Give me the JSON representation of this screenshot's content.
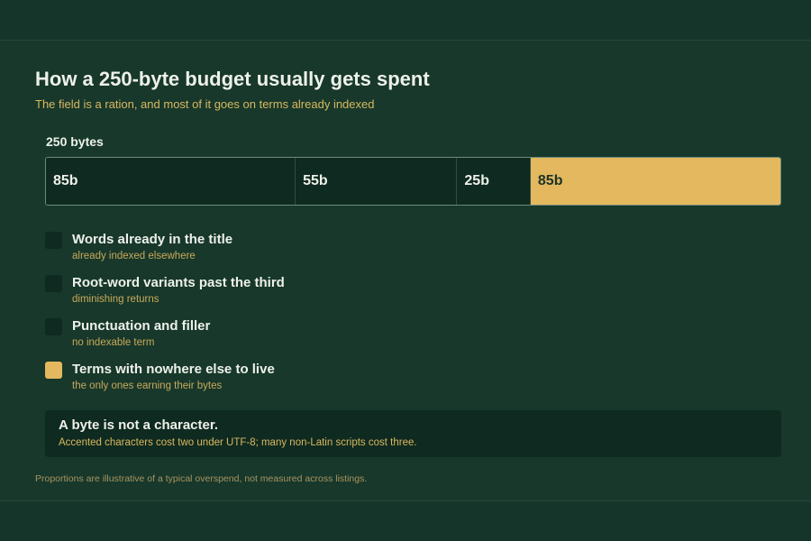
{
  "title": "How a 250-byte budget usually gets spent",
  "subtitle": "The field is a ration, and most of it goes on terms already indexed",
  "chart_data": {
    "type": "bar",
    "orientation": "horizontal-stacked",
    "total": 250,
    "total_label": "250 bytes",
    "unit": "bytes",
    "categories": [
      "Words already in the title",
      "Root-word variants past the third",
      "Punctuation and filler",
      "Terms with nowhere else to live"
    ],
    "values": [
      85,
      55,
      25,
      85
    ],
    "value_labels": [
      "85b",
      "55b",
      "25b",
      "85b"
    ],
    "notes": [
      "already indexed elsewhere",
      "diminishing returns",
      "no indexable term",
      "the only ones earning their bytes"
    ],
    "colors": [
      "#0f2a20",
      "#0f2a20",
      "#0f2a20",
      "#e3b85e"
    ],
    "label_colors": [
      "#eef1ea",
      "#eef1ea",
      "#eef1ea",
      "#1b3328"
    ],
    "legend_placement": "below"
  },
  "callout": {
    "title": "A byte is not a character.",
    "body": "Accented characters cost two under UTF-8; many non-Latin scripts cost three."
  },
  "footnote": "Proportions are illustrative of a typical overspend, not measured across listings."
}
